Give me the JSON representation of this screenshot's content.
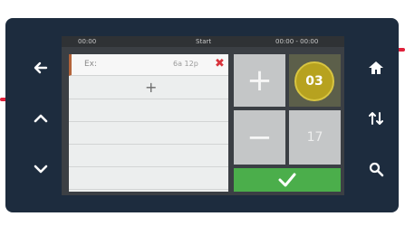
{
  "status_bar": {
    "left": "00:00",
    "center": "Start",
    "right": "00:00 - 00:00"
  },
  "list": {
    "row1_text": "Ex:",
    "row1_times": "6a 12p",
    "delete_glyph": "✖",
    "add_glyph": "+"
  },
  "controls": {
    "plus_glyph": "+",
    "minus_glyph": "−",
    "dial_value": "03",
    "secondary_value": "17"
  },
  "colors": {
    "frame": "#1d2c3e",
    "pointer_markers": "#e0213b",
    "dial": "#b7a21f",
    "confirm": "#4bae4b",
    "delete": "#d8343c"
  },
  "icons": {
    "left_buttons": [
      "back-arrow-icon",
      "chevron-up-icon",
      "chevron-down-icon"
    ],
    "right_buttons": [
      "home-icon",
      "swap-icon",
      "search-icon"
    ],
    "confirm": "checkmark-icon"
  }
}
